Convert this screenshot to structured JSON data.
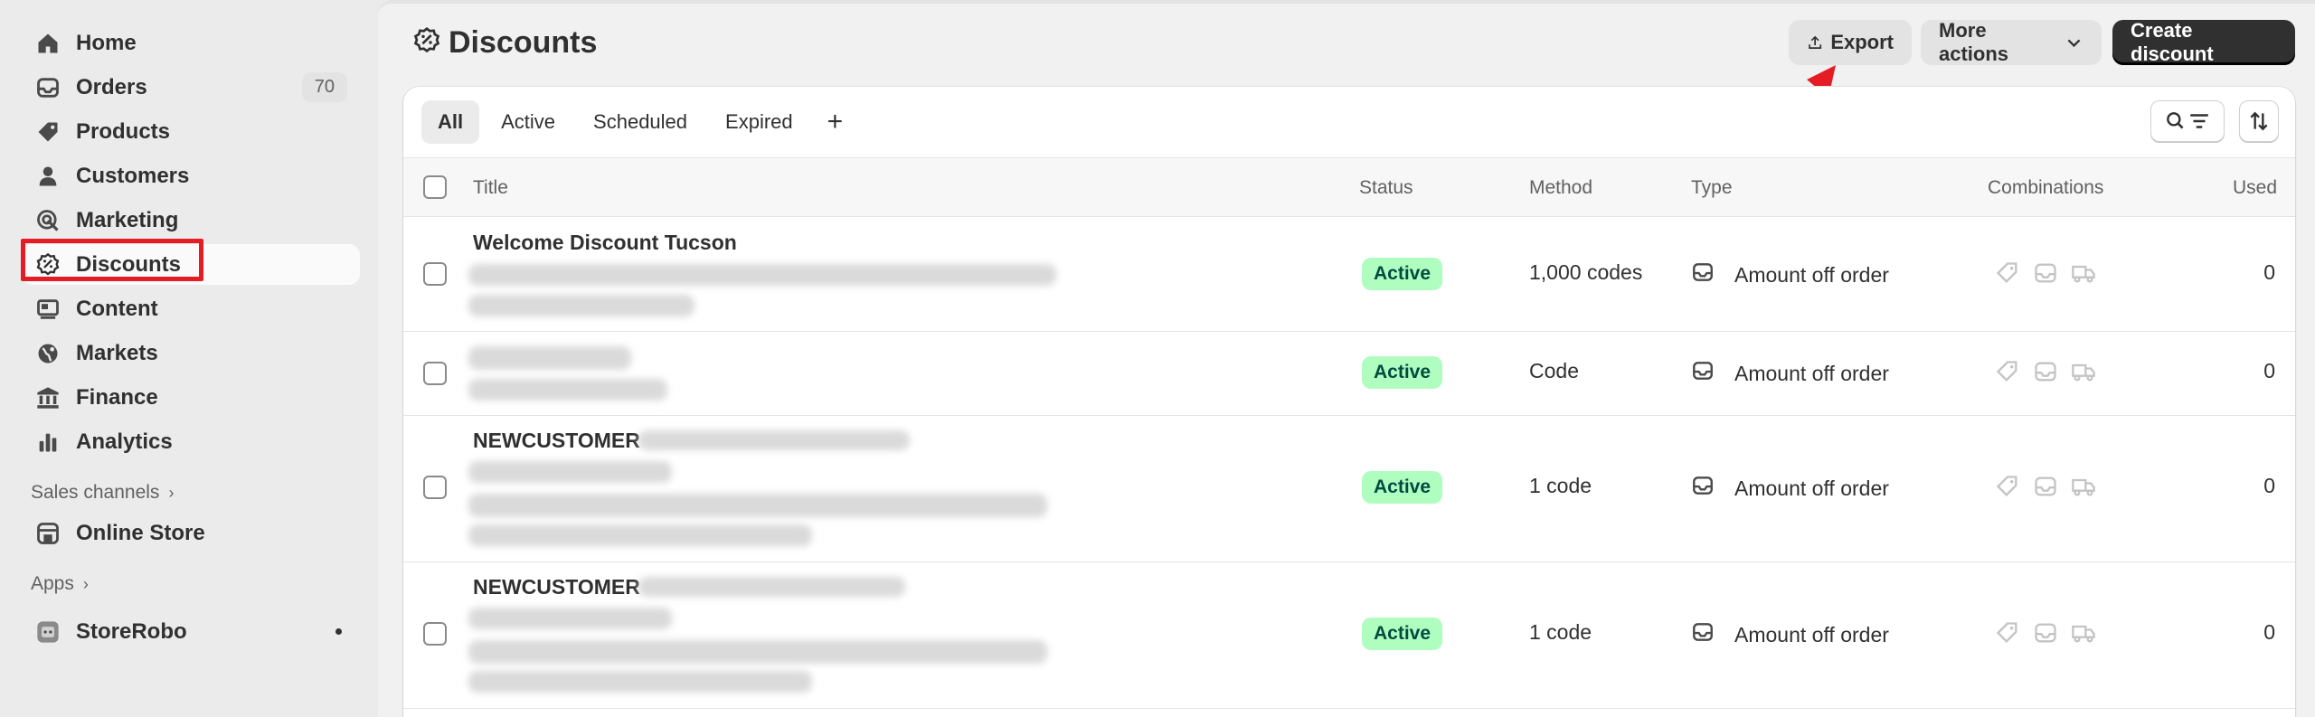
{
  "sidebar": {
    "items": [
      {
        "label": "Home",
        "icon": "home-icon"
      },
      {
        "label": "Orders",
        "icon": "orders-icon",
        "badge": "70"
      },
      {
        "label": "Products",
        "icon": "tag-icon"
      },
      {
        "label": "Customers",
        "icon": "person-icon"
      },
      {
        "label": "Marketing",
        "icon": "target-icon"
      },
      {
        "label": "Discounts",
        "icon": "discount-icon"
      },
      {
        "label": "Content",
        "icon": "content-icon"
      },
      {
        "label": "Markets",
        "icon": "globe-icon"
      },
      {
        "label": "Finance",
        "icon": "bank-icon"
      },
      {
        "label": "Analytics",
        "icon": "bar-chart-icon"
      }
    ],
    "sales_channels_label": "Sales channels",
    "online_store_label": "Online Store",
    "apps_label": "Apps",
    "storerobo_label": "StoreRobo"
  },
  "header": {
    "title": "Discounts",
    "export_label": "Export",
    "more_actions_label": "More actions",
    "create_label": "Create discount"
  },
  "tabs": [
    "All",
    "Active",
    "Scheduled",
    "Expired"
  ],
  "table": {
    "columns": {
      "title": "Title",
      "status": "Status",
      "method": "Method",
      "type": "Type",
      "combinations": "Combinations",
      "used": "Used"
    },
    "rows": [
      {
        "title": "Welcome Discount Tucson",
        "status": "Active",
        "method": "1,000 codes",
        "type": "Amount off order",
        "used": "0"
      },
      {
        "title": "",
        "status": "Active",
        "method": "Code",
        "type": "Amount off order",
        "used": "0"
      },
      {
        "title": "NEWCUSTOMER",
        "status": "Active",
        "method": "1 code",
        "type": "Amount off order",
        "used": "0"
      },
      {
        "title": "NEWCUSTOMER",
        "status": "Active",
        "method": "1 code",
        "type": "Amount off order",
        "used": "0"
      }
    ]
  },
  "colors": {
    "highlight": "#e51c23",
    "active_badge_bg": "#affebf",
    "primary_button": "#303030"
  }
}
